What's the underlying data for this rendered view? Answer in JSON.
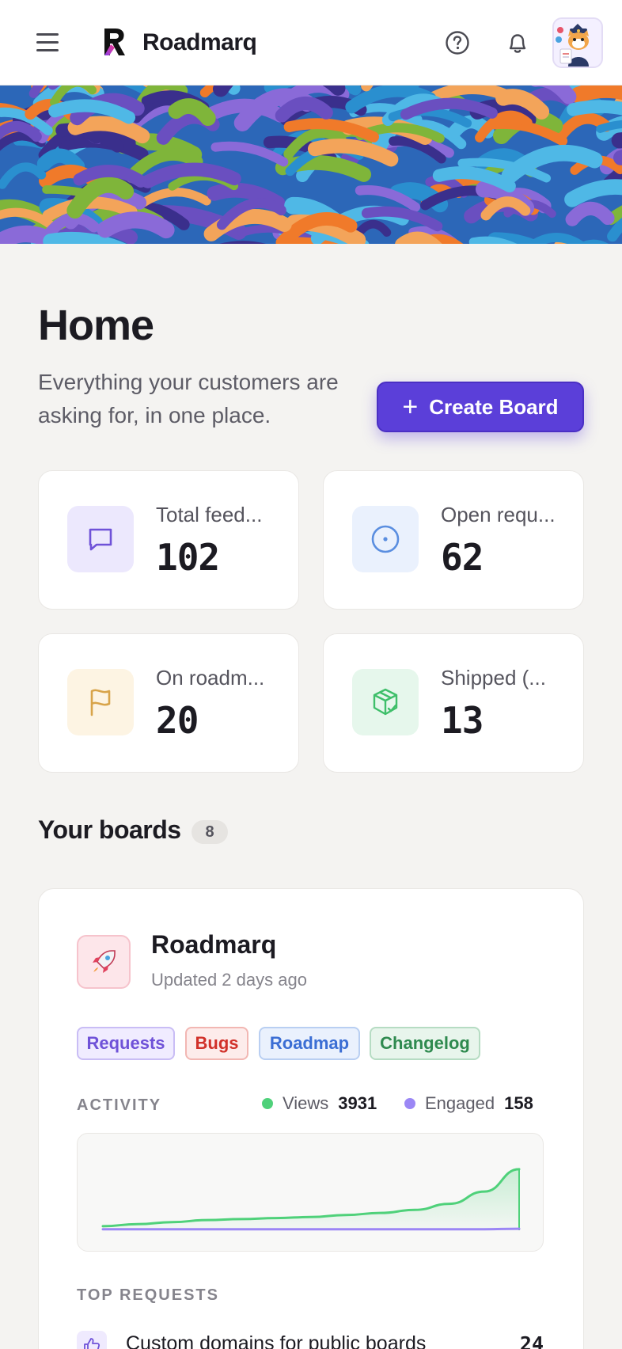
{
  "header": {
    "brand": "Roadmarq",
    "icons": [
      "menu-icon",
      "help-icon",
      "bell-icon"
    ]
  },
  "page": {
    "title": "Home",
    "subtitle": "Everything your customers are asking for, in one place.",
    "create_button": {
      "icon": "+",
      "label": "Create Board"
    }
  },
  "stats": [
    {
      "label": "Total feed...",
      "value": "102",
      "icon": "chat-icon",
      "color": "#6f52d8",
      "bg": "#ece8fd"
    },
    {
      "label": "Open requ...",
      "value": "62",
      "icon": "target-icon",
      "color": "#5a8ee0",
      "bg": "#eaf1fd"
    },
    {
      "label": "On roadm...",
      "value": "20",
      "icon": "flag-icon",
      "color": "#d8a44a",
      "bg": "#fdf4e3"
    },
    {
      "label": "Shipped (...",
      "value": "13",
      "icon": "package-icon",
      "color": "#3fbf6a",
      "bg": "#e6f7ec"
    }
  ],
  "boards": {
    "title": "Your boards",
    "count": "8",
    "items": [
      {
        "name": "Roadmarq",
        "updated": "Updated 2 days ago",
        "icon": "rocket-icon",
        "tags": [
          "Requests",
          "Bugs",
          "Roadmap",
          "Changelog"
        ],
        "activity_label": "ACTIVITY",
        "views_label": "Views",
        "views": "3931",
        "engaged_label": "Engaged",
        "engaged": "158",
        "top_requests_label": "TOP REQUESTS",
        "top_requests": [
          {
            "title": "Custom domains for public boards",
            "count": "24"
          }
        ]
      }
    ]
  },
  "colors": {
    "accent": "#5b3fd9",
    "views_line": "#4fd17a",
    "engaged_line": "#9b87f5"
  },
  "chart_data": {
    "type": "line",
    "series": [
      {
        "name": "Views",
        "values": [
          4,
          6,
          8,
          10,
          11,
          12,
          13,
          15,
          17,
          20,
          26,
          38,
          60
        ]
      },
      {
        "name": "Engaged",
        "values": [
          1,
          1,
          1,
          1,
          1,
          1,
          1,
          1,
          1,
          1,
          1,
          1,
          1.5
        ]
      }
    ],
    "ylim": [
      0,
      70
    ],
    "grid": false,
    "legend": "top-right"
  }
}
